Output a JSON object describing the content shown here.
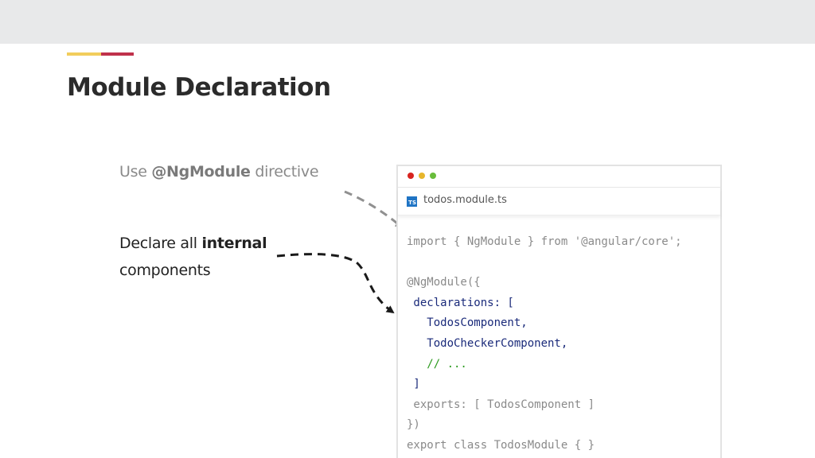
{
  "slide": {
    "title": "Module Declaration",
    "accent_colors": [
      "#f2cd5c",
      "#c0314b"
    ]
  },
  "annotations": {
    "note1": {
      "prefix": "Use ",
      "bold": "@NgModule",
      "suffix": " directive"
    },
    "note2": {
      "prefix": "Declare all ",
      "bold": "internal",
      "line2": "components"
    }
  },
  "editor": {
    "window_controls": [
      "close-dot",
      "minimize-dot",
      "maximize-dot"
    ],
    "tab": {
      "icon_label": "TS",
      "filename": "todos.module.ts"
    },
    "code_lines": [
      "import { NgModule } from '@angular/core';",
      "",
      "@NgModule({",
      " declarations: [",
      "   TodosComponent,",
      "   TodoCheckerComponent,",
      "   // ...",
      " ]",
      " exports: [ TodosComponent ]",
      "})",
      "export class TodosModule { }"
    ]
  }
}
